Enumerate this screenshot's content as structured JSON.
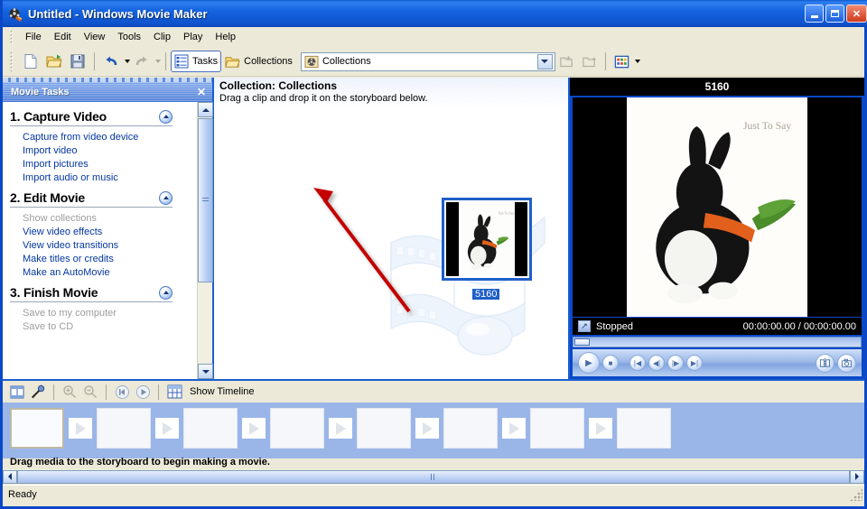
{
  "window": {
    "title_file": "Untitled",
    "title_sep": " - ",
    "title_app": "Windows Movie Maker",
    "icon": "movie-reel-icon",
    "minimize": "_",
    "maximize": "□",
    "close": "✕"
  },
  "menu": [
    "File",
    "Edit",
    "View",
    "Tools",
    "Clip",
    "Play",
    "Help"
  ],
  "toolbar": {
    "new_label": "New Project",
    "open_label": "Open Project",
    "save_label": "Save Project",
    "undo_label": "Undo",
    "redo_label": "Redo",
    "tasks_label": "Tasks",
    "collections_label": "Collections",
    "combo_value": "Collections",
    "views_label": "Views"
  },
  "sidebar": {
    "header": "Movie Tasks",
    "close": "✕",
    "sections": [
      {
        "title": "1. Capture Video",
        "links": [
          {
            "label": "Capture from video device",
            "disabled": false
          },
          {
            "label": "Import video",
            "disabled": false
          },
          {
            "label": "Import pictures",
            "disabled": false
          },
          {
            "label": "Import audio or music",
            "disabled": false
          }
        ]
      },
      {
        "title": "2. Edit Movie",
        "links": [
          {
            "label": "Show collections",
            "disabled": true
          },
          {
            "label": "View video effects",
            "disabled": false
          },
          {
            "label": "View video transitions",
            "disabled": false
          },
          {
            "label": "Make titles or credits",
            "disabled": false
          },
          {
            "label": "Make an AutoMovie",
            "disabled": false
          }
        ]
      },
      {
        "title": "3. Finish Movie",
        "links": [
          {
            "label": "Save to my computer",
            "disabled": true
          },
          {
            "label": "Save to CD",
            "disabled": true
          }
        ]
      }
    ]
  },
  "collections": {
    "title": "Collection: Collections",
    "subtitle": "Drag a clip and drop it on the storyboard below.",
    "clips": [
      {
        "name": "5160",
        "selected": true
      }
    ]
  },
  "preview": {
    "title": "5160",
    "status": "Stopped",
    "time": "00:00:00.00 / 00:00:00.00",
    "image_caption": "Just To Say",
    "buttons": {
      "play": "▶",
      "stop": "■",
      "prev_clip": "◀|",
      "step_back": "◀|",
      "step_fwd": "|▶",
      "next_clip": "|▶",
      "split": "split-clip",
      "snapshot": "take-picture"
    }
  },
  "storyboard": {
    "toolbar": {
      "storyboard_label": "Storyboard",
      "narrate_label": "Narrate Timeline",
      "zoom_in_label": "Zoom In",
      "zoom_out_label": "Zoom Out",
      "rewind_label": "Rewind Timeline",
      "play_label": "Play Timeline",
      "show_timeline_label": "Show Timeline"
    },
    "hint": "Drag media to the storyboard to begin making a movie.",
    "cells": 8,
    "selected_cell": 0
  },
  "status": {
    "text": "Ready"
  },
  "colors": {
    "titlebar": "#1463e0",
    "accent": "#0a48c8",
    "link": "#0437a0",
    "board": "#9ab6e8",
    "selection": "#1f5fc8",
    "annotation": "#c40000"
  }
}
